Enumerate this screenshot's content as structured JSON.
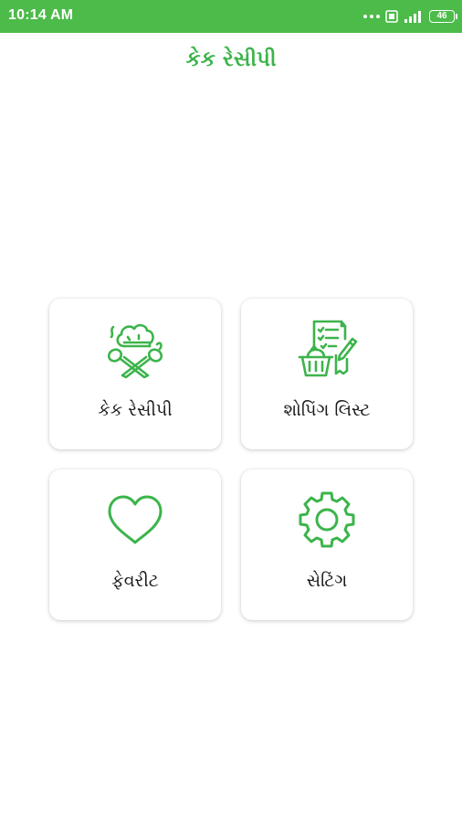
{
  "status_bar": {
    "time": "10:14 AM",
    "battery": "46"
  },
  "app": {
    "title": "કેક રેસીપી"
  },
  "menu": [
    {
      "label": "કેક રેસીપી",
      "icon": "chef-hat-spoons-icon"
    },
    {
      "label": "શોપિંગ લિસ્ટ",
      "icon": "shopping-list-basket-icon"
    },
    {
      "label": "ફેવરીટ",
      "icon": "heart-icon"
    },
    {
      "label": "સેટિંગ",
      "icon": "gear-icon"
    }
  ],
  "colors": {
    "accent": "#3cb44b",
    "status_bar": "#4cbb4a"
  }
}
